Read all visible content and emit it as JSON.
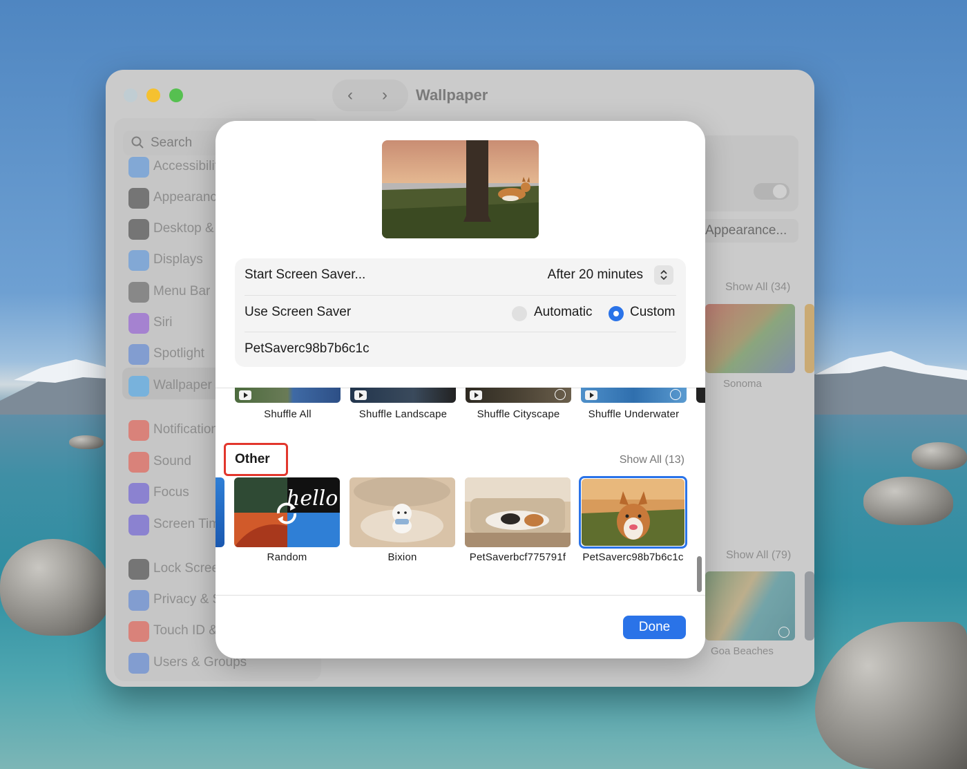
{
  "window": {
    "title": "Wallpaper",
    "nav_back": "‹",
    "nav_forward": "›"
  },
  "sidebar": {
    "search_placeholder": "Search",
    "items": [
      {
        "label": "Accessibility",
        "icon": "accessibility-icon",
        "color": "#4a90e2"
      },
      {
        "label": "Appearance",
        "icon": "appearance-icon",
        "color": "#333333"
      },
      {
        "label": "Desktop & Dock",
        "icon": "dock-icon",
        "color": "#333333"
      },
      {
        "label": "Displays",
        "icon": "displays-icon",
        "color": "#4a90e2"
      },
      {
        "label": "Menu Bar",
        "icon": "menubar-icon",
        "color": "#555555"
      },
      {
        "label": "Siri",
        "icon": "siri-icon",
        "color": "#8a4bd8"
      },
      {
        "label": "Spotlight",
        "icon": "spotlight-icon",
        "color": "#4a7bd8"
      },
      {
        "label": "Wallpaper",
        "icon": "wallpaper-icon",
        "color": "#3fa9f5"
      },
      {
        "label": "Notifications",
        "icon": "notifications-icon",
        "color": "#e94b3c"
      },
      {
        "label": "Sound",
        "icon": "sound-icon",
        "color": "#e94b3c"
      },
      {
        "label": "Focus",
        "icon": "focus-icon",
        "color": "#5b4bd8"
      },
      {
        "label": "Screen Time",
        "icon": "screen-time-icon",
        "color": "#5b4bd8"
      },
      {
        "label": "Lock Screen",
        "icon": "lock-screen-icon",
        "color": "#333333"
      },
      {
        "label": "Privacy & Security",
        "icon": "privacy-icon",
        "color": "#4a7bd8"
      },
      {
        "label": "Touch ID & Password",
        "icon": "touchid-icon",
        "color": "#e94b3c"
      },
      {
        "label": "Users & Groups",
        "icon": "users-icon",
        "color": "#4a7bd8"
      }
    ]
  },
  "background_panel": {
    "appearance_button": "Appearance...",
    "show_all_dynamic": "Show All (34)",
    "sonoma_label": "Sonoma",
    "show_all_landscape": "Show All (79)",
    "goa_label": "Goa Beaches"
  },
  "sheet": {
    "start_screen_saver_label": "Start Screen Saver...",
    "start_screen_saver_value": "After 20 minutes",
    "use_screen_saver_label": "Use Screen Saver",
    "option_automatic": "Automatic",
    "option_custom": "Custom",
    "selected_saver": "PetSaverc98b7b6c1c",
    "shuffle_row": [
      {
        "label": "Shuffle All"
      },
      {
        "label": "Shuffle Landscape"
      },
      {
        "label": "Shuffle Cityscape"
      },
      {
        "label": "Shuffle Underwater"
      }
    ],
    "other_section": {
      "title": "Other",
      "show_all": "Show All (13)",
      "items": [
        {
          "label": "Random"
        },
        {
          "label": "Bixion"
        },
        {
          "label": "PetSaverbcf775791f"
        },
        {
          "label": "PetSaverc98b7b6c1c"
        }
      ]
    },
    "random_thumb_text": "hello",
    "done_label": "Done",
    "accent_color": "#2a73e8",
    "highlight_color": "#e2362c"
  }
}
